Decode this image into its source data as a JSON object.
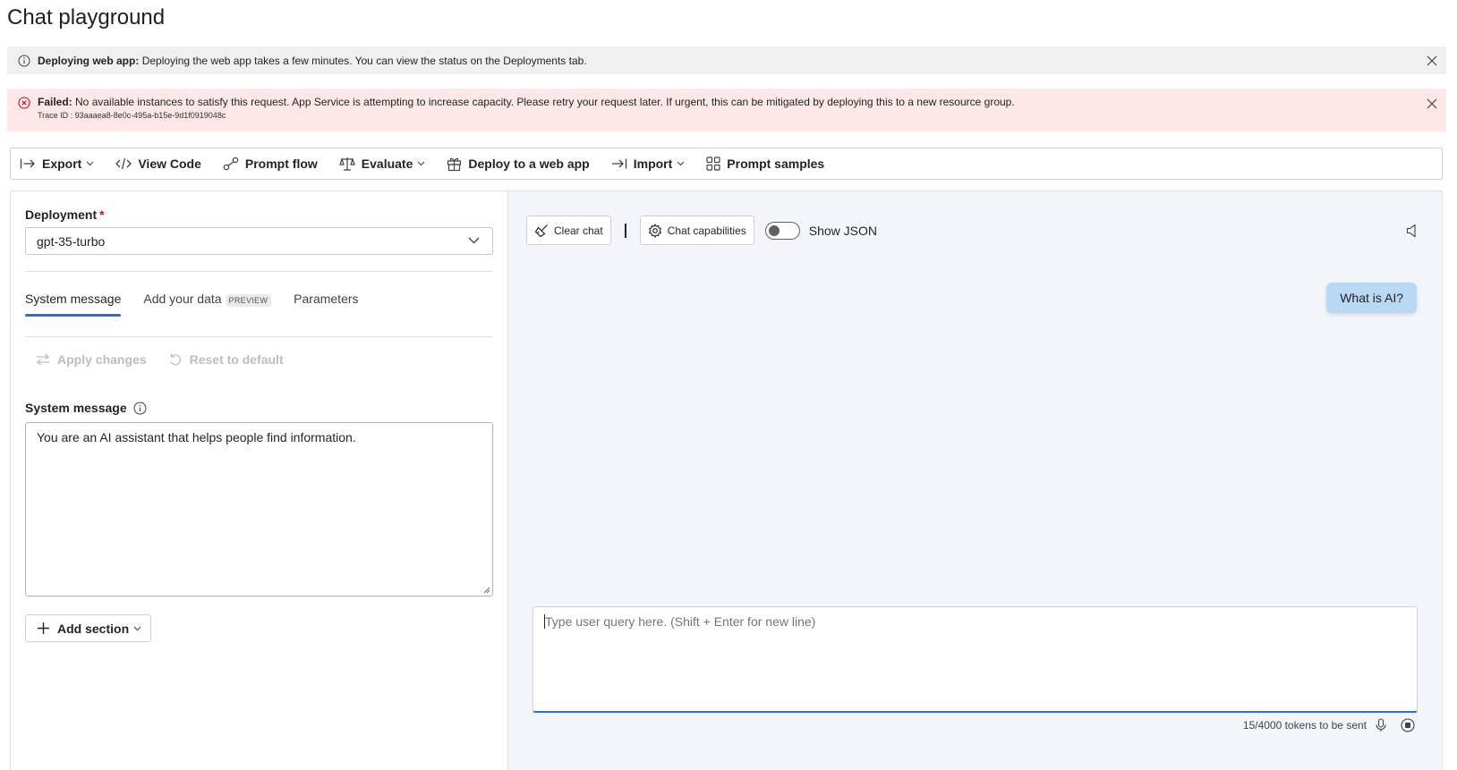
{
  "page_title": "Chat playground",
  "info_banner": {
    "title": "Deploying web app:",
    "message": "Deploying the web app takes a few minutes. You can view the status on the Deployments tab."
  },
  "error_banner": {
    "title": "Failed:",
    "message": "No available instances to satisfy this request. App Service is attempting to increase capacity. Please retry your request later. If urgent, this can be mitigated by deploying this to a new resource group.",
    "trace": "Trace ID : 93aaaea8-8e0c-495a-b15e-9d1f0919048c"
  },
  "toolbar": {
    "export": "Export",
    "view_code": "View Code",
    "prompt_flow": "Prompt flow",
    "evaluate": "Evaluate",
    "deploy": "Deploy to a web app",
    "import": "Import",
    "prompt_samples": "Prompt samples"
  },
  "setup": {
    "deployment_label": "Deployment",
    "required_mark": "*",
    "deployment_value": "gpt-35-turbo",
    "tabs": {
      "system_message": "System message",
      "add_data": "Add your data",
      "preview": "PREVIEW",
      "parameters": "Parameters"
    },
    "apply_changes": "Apply changes",
    "reset_default": "Reset to default",
    "system_message_label": "System message",
    "system_message_value": "You are an AI assistant that helps people find information.",
    "add_section": "Add section"
  },
  "chat": {
    "clear_chat": "Clear chat",
    "chat_capabilities": "Chat capabilities",
    "show_json": "Show JSON",
    "user_message": "What is AI?",
    "input_placeholder": "Type user query here. (Shift + Enter for new line)",
    "tokens": "15/4000 tokens to be sent"
  }
}
